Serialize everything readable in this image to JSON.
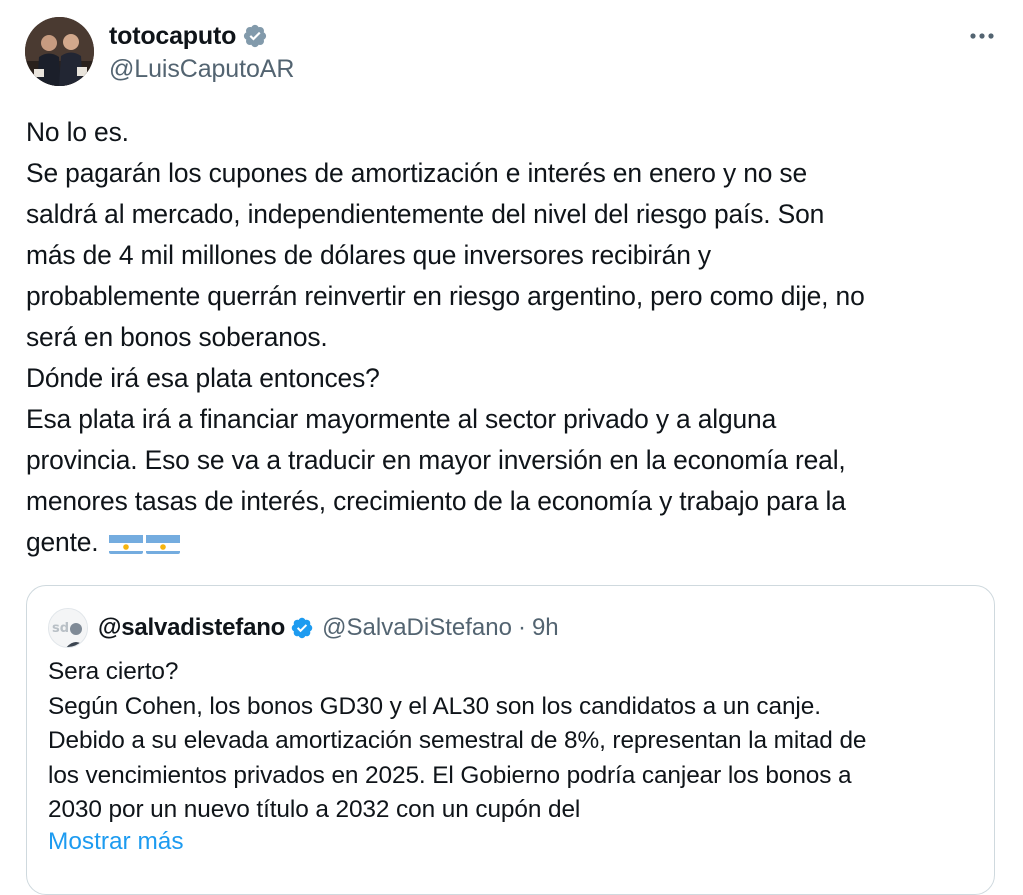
{
  "author": {
    "display_name": "totocaputo",
    "handle": "@LuisCaputoAR",
    "verified": true
  },
  "tweet": {
    "lines": [
      "No lo es.",
      "Se pagarán los cupones de amortización e interés en enero y no se",
      "saldrá al mercado, independientemente del nivel del riesgo país. Son",
      "más de 4 mil millones de dólares que inversores recibirán y",
      "probablemente querrán reinvertir en riesgo argentino, pero como dije, no",
      "será en bonos soberanos.",
      "Dónde irá esa plata entonces?",
      "Esa plata irá a financiar mayormente al sector privado y a alguna",
      "provincia. Eso se va a traducir en mayor inversión en la economía real,",
      "menores tasas de interés, crecimiento de la economía y trabajo para la",
      "gente."
    ],
    "emojis": [
      "argentina-flag",
      "argentina-flag"
    ]
  },
  "quote": {
    "display_name": "@salvadistefano",
    "handle": "@SalvaDiStefano",
    "separator": "·",
    "time": "9h",
    "verified": true,
    "lines": [
      "Sera cierto?",
      "Según Cohen, los bonos GD30 y el AL30 son los candidatos a un canje.",
      "Debido a su elevada amortización semestral de 8%, representan la mitad de",
      "los vencimientos privados en 2025. El Gobierno podría canjear los bonos a",
      "2030 por un nuevo título a 2032 con un cupón del"
    ],
    "show_more": "Mostrar más"
  },
  "colors": {
    "text": "#0f1419",
    "secondary": "#536471",
    "link": "#1d9bf0",
    "verified": "#1d9bf0",
    "verified_gray": "#829aab",
    "border": "#cfd9de"
  }
}
